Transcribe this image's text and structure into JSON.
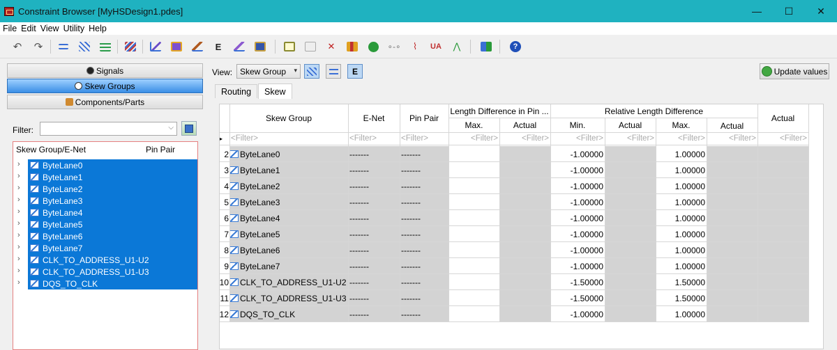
{
  "window": {
    "title": "Constraint Browser [MyHSDesign1.pdes]",
    "controls": {
      "minimize": "—",
      "maximize": "☐",
      "close": "✕"
    }
  },
  "menu": [
    "File",
    "Edit",
    "View",
    "Utility",
    "Help"
  ],
  "toolbar": {
    "icons": [
      "undo-icon",
      "redo-icon",
      "net-icon",
      "bus-icon",
      "diff-pair-icon",
      "netgroup-icon",
      "rule-edit-icon",
      "report-icon",
      "pen-icon",
      "enet-icon",
      "wand-icon",
      "save-icon",
      "copy-icon",
      "page-icon",
      "cross-icon",
      "chart-icon",
      "green-circle-icon",
      "topology-icon",
      "waveform-icon",
      "ua-icon",
      "graph-icon",
      "layout-icon",
      "help-icon"
    ]
  },
  "left": {
    "nav": [
      {
        "label": "Signals",
        "active": false
      },
      {
        "label": "Skew Groups",
        "active": true
      },
      {
        "label": "Components/Parts",
        "active": false
      }
    ],
    "filter_label": "Filter:",
    "filter_value": "",
    "tree_headers": {
      "name": "Skew Group/E-Net",
      "pin_pair": "Pin Pair"
    },
    "tree_items": [
      "ByteLane0",
      "ByteLane1",
      "ByteLane2",
      "ByteLane3",
      "ByteLane4",
      "ByteLane5",
      "ByteLane6",
      "ByteLane7",
      "CLK_TO_ADDRESS_U1-U2",
      "CLK_TO_ADDRESS_U1-U3",
      "DQS_TO_CLK"
    ]
  },
  "right": {
    "view_label": "View:",
    "view_value": "Skew Group",
    "update_label": "Update values",
    "tabs": [
      {
        "label": "Routing",
        "active": false
      },
      {
        "label": "Skew",
        "active": true
      }
    ],
    "grid": {
      "group_headers": {
        "length_diff": "Length Difference in Pin ...",
        "relative": "Relative Length Difference"
      },
      "headers": {
        "skew_group": "Skew Group",
        "enet": "E-Net",
        "pin_pair": "Pin Pair",
        "ld_max": "Max.",
        "ld_actual": "Actual",
        "rl_min": "Min.",
        "rl_actual": "Actual",
        "rl_max": "Max.",
        "rl_actual2": "Actual",
        "actual": "Actual"
      },
      "filter_placeholder": "<Filter>",
      "rows": [
        {
          "num": "2",
          "name": "ByteLane0",
          "enet": "-------",
          "pin": "-------",
          "min": "-1.00000",
          "max": "1.00000"
        },
        {
          "num": "3",
          "name": "ByteLane1",
          "enet": "-------",
          "pin": "-------",
          "min": "-1.00000",
          "max": "1.00000"
        },
        {
          "num": "4",
          "name": "ByteLane2",
          "enet": "-------",
          "pin": "-------",
          "min": "-1.00000",
          "max": "1.00000"
        },
        {
          "num": "5",
          "name": "ByteLane3",
          "enet": "-------",
          "pin": "-------",
          "min": "-1.00000",
          "max": "1.00000"
        },
        {
          "num": "6",
          "name": "ByteLane4",
          "enet": "-------",
          "pin": "-------",
          "min": "-1.00000",
          "max": "1.00000"
        },
        {
          "num": "7",
          "name": "ByteLane5",
          "enet": "-------",
          "pin": "-------",
          "min": "-1.00000",
          "max": "1.00000"
        },
        {
          "num": "8",
          "name": "ByteLane6",
          "enet": "-------",
          "pin": "-------",
          "min": "-1.00000",
          "max": "1.00000"
        },
        {
          "num": "9",
          "name": "ByteLane7",
          "enet": "-------",
          "pin": "-------",
          "min": "-1.00000",
          "max": "1.00000"
        },
        {
          "num": "10",
          "name": "CLK_TO_ADDRESS_U1-U2",
          "enet": "-------",
          "pin": "-------",
          "min": "-1.50000",
          "max": "1.50000"
        },
        {
          "num": "11",
          "name": "CLK_TO_ADDRESS_U1-U3",
          "enet": "-------",
          "pin": "-------",
          "min": "-1.50000",
          "max": "1.50000"
        },
        {
          "num": "12",
          "name": "DQS_TO_CLK",
          "enet": "-------",
          "pin": "-------",
          "min": "-1.00000",
          "max": "1.00000"
        }
      ]
    }
  },
  "colors": {
    "titlebar": "#1fb2c0",
    "selection": "#0b78d7",
    "readonly_cell": "#d3d3d3"
  }
}
